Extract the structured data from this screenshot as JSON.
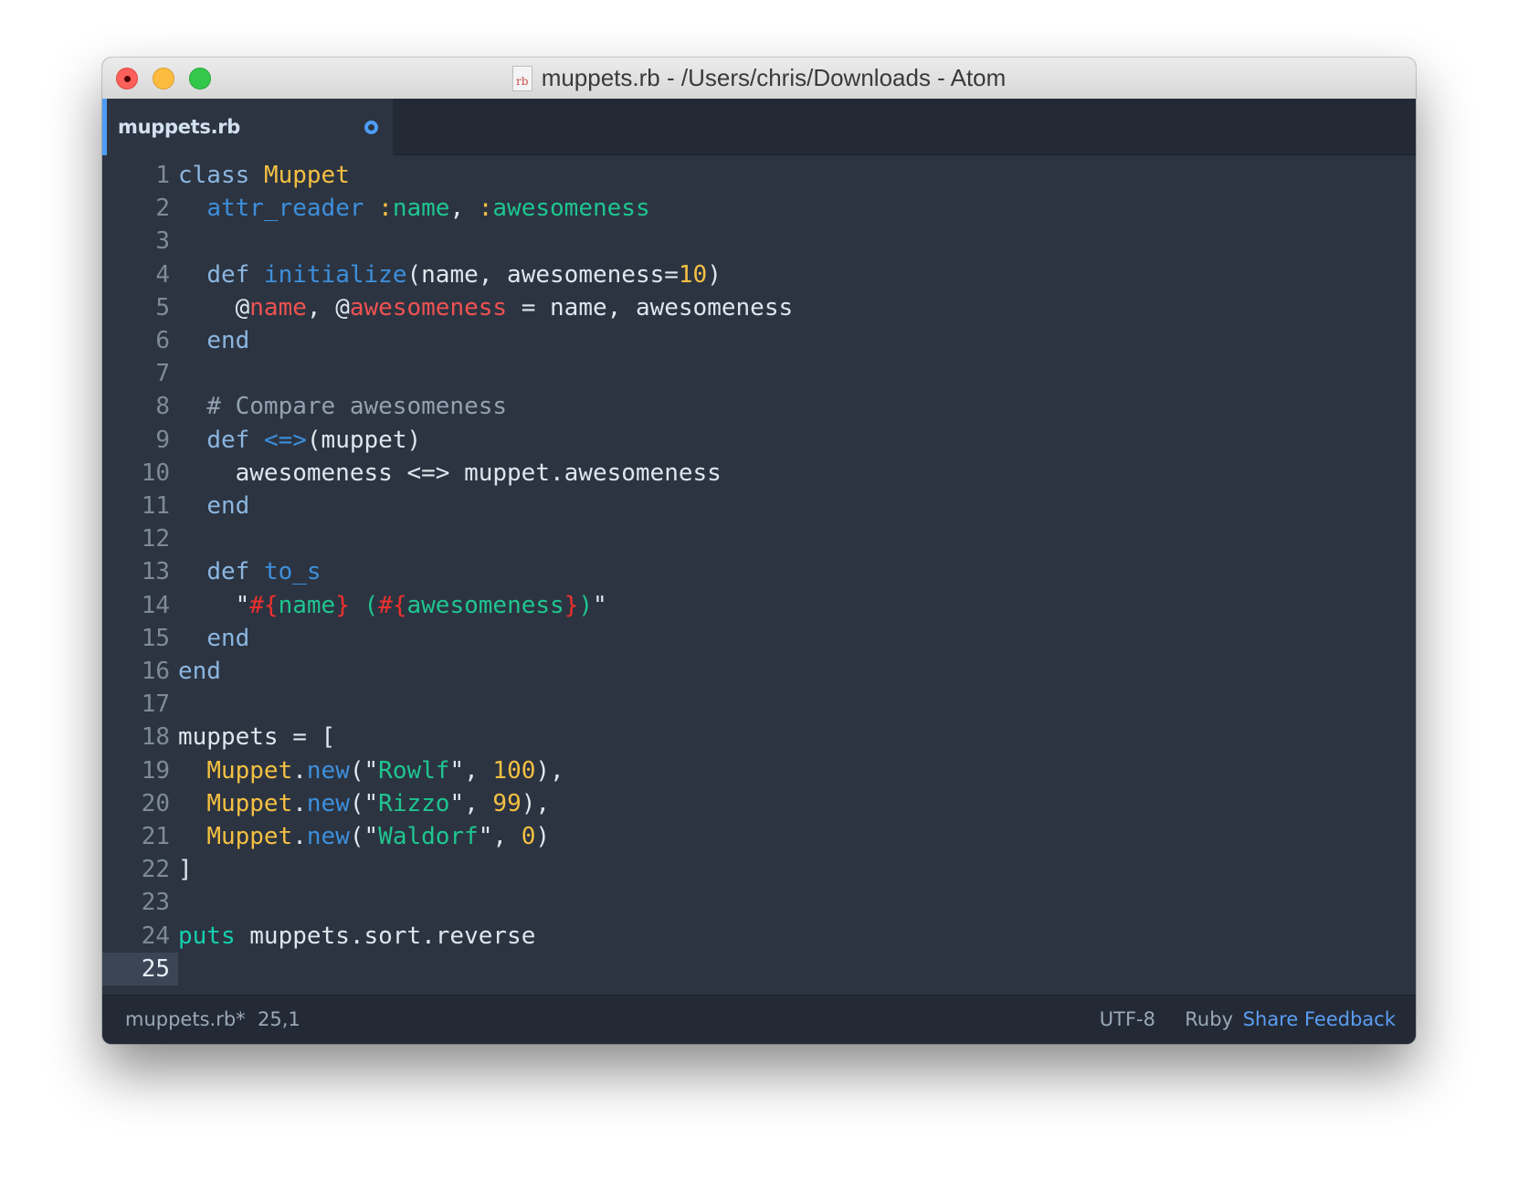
{
  "window": {
    "title": "muppets.rb - /Users/chris/Downloads - Atom",
    "file_icon_label": "rb",
    "controls": [
      "close",
      "minimize",
      "maximize"
    ]
  },
  "tabs": [
    {
      "label": "muppets.rb",
      "active": true,
      "modified": true
    }
  ],
  "editor": {
    "language": "Ruby",
    "cursor_line": 25,
    "lines": [
      [
        [
          "kw",
          "class"
        ],
        [
          "plain",
          " "
        ],
        [
          "cls",
          "Muppet"
        ]
      ],
      [
        [
          "plain",
          "  "
        ],
        [
          "fn",
          "attr_reader"
        ],
        [
          "plain",
          " "
        ],
        [
          "cls",
          ":"
        ],
        [
          "sym",
          "name"
        ],
        [
          "plain",
          ", "
        ],
        [
          "cls",
          ":"
        ],
        [
          "sym",
          "awesomeness"
        ]
      ],
      [],
      [
        [
          "plain",
          "  "
        ],
        [
          "kw",
          "def"
        ],
        [
          "plain",
          " "
        ],
        [
          "fn",
          "initialize"
        ],
        [
          "plain",
          "(name, awesomeness="
        ],
        [
          "num",
          "10"
        ],
        [
          "plain",
          ")"
        ]
      ],
      [
        [
          "plain",
          "    @"
        ],
        [
          "ivar",
          "name"
        ],
        [
          "plain",
          ", @"
        ],
        [
          "ivar",
          "awesomeness"
        ],
        [
          "plain",
          " = name, awesomeness"
        ]
      ],
      [
        [
          "plain",
          "  "
        ],
        [
          "kw",
          "end"
        ]
      ],
      [],
      [
        [
          "plain",
          "  "
        ],
        [
          "cm",
          "# Compare awesomeness"
        ]
      ],
      [
        [
          "plain",
          "  "
        ],
        [
          "kw",
          "def"
        ],
        [
          "plain",
          " "
        ],
        [
          "fn",
          "<=>"
        ],
        [
          "plain",
          "(muppet)"
        ]
      ],
      [
        [
          "plain",
          "    awesomeness <=> muppet.awesomeness"
        ]
      ],
      [
        [
          "plain",
          "  "
        ],
        [
          "kw",
          "end"
        ]
      ],
      [],
      [
        [
          "plain",
          "  "
        ],
        [
          "kw",
          "def"
        ],
        [
          "plain",
          " "
        ],
        [
          "fn",
          "to_s"
        ]
      ],
      [
        [
          "plain",
          "    \""
        ],
        [
          "interp",
          "#{"
        ],
        [
          "str",
          "name"
        ],
        [
          "interp",
          "}"
        ],
        [
          "str",
          " ("
        ],
        [
          "interp",
          "#{"
        ],
        [
          "str",
          "awesomeness"
        ],
        [
          "interp",
          "}"
        ],
        [
          "str",
          ")"
        ],
        [
          "plain",
          "\""
        ]
      ],
      [
        [
          "plain",
          "  "
        ],
        [
          "kw",
          "end"
        ]
      ],
      [
        [
          "kw",
          "end"
        ]
      ],
      [],
      [
        [
          "plain",
          "muppets = ["
        ]
      ],
      [
        [
          "plain",
          "  "
        ],
        [
          "cls",
          "Muppet"
        ],
        [
          "plain",
          "."
        ],
        [
          "fn",
          "new"
        ],
        [
          "plain",
          "(\""
        ],
        [
          "str",
          "Rowlf"
        ],
        [
          "plain",
          "\", "
        ],
        [
          "num",
          "100"
        ],
        [
          "plain",
          "),"
        ]
      ],
      [
        [
          "plain",
          "  "
        ],
        [
          "cls",
          "Muppet"
        ],
        [
          "plain",
          "."
        ],
        [
          "fn",
          "new"
        ],
        [
          "plain",
          "(\""
        ],
        [
          "str",
          "Rizzo"
        ],
        [
          "plain",
          "\", "
        ],
        [
          "num",
          "99"
        ],
        [
          "plain",
          "),"
        ]
      ],
      [
        [
          "plain",
          "  "
        ],
        [
          "cls",
          "Muppet"
        ],
        [
          "plain",
          "."
        ],
        [
          "fn",
          "new"
        ],
        [
          "plain",
          "(\""
        ],
        [
          "str",
          "Waldorf"
        ],
        [
          "plain",
          "\", "
        ],
        [
          "num",
          "0"
        ],
        [
          "plain",
          ")"
        ]
      ],
      [
        [
          "plain",
          "]"
        ]
      ],
      [],
      [
        [
          "builtin",
          "puts"
        ],
        [
          "plain",
          " muppets.sort.reverse"
        ]
      ],
      []
    ]
  },
  "statusbar": {
    "file": "muppets.rb*",
    "cursor_position": "25,1",
    "encoding": "UTF-8",
    "grammar": "Ruby",
    "feedback_link": "Share Feedback"
  },
  "colors": {
    "accent": "#4d9df7",
    "editor_bg": "#2c3441",
    "tabbar_bg": "#232a35",
    "keyword": "#8bb6e0",
    "class": "#f5c042",
    "function": "#3d8fdc",
    "string": "#1fc590",
    "ivar": "#f05252",
    "interpolation": "#f0302e",
    "comment": "#93a1b0",
    "feedback_link": "#5b9df3"
  }
}
